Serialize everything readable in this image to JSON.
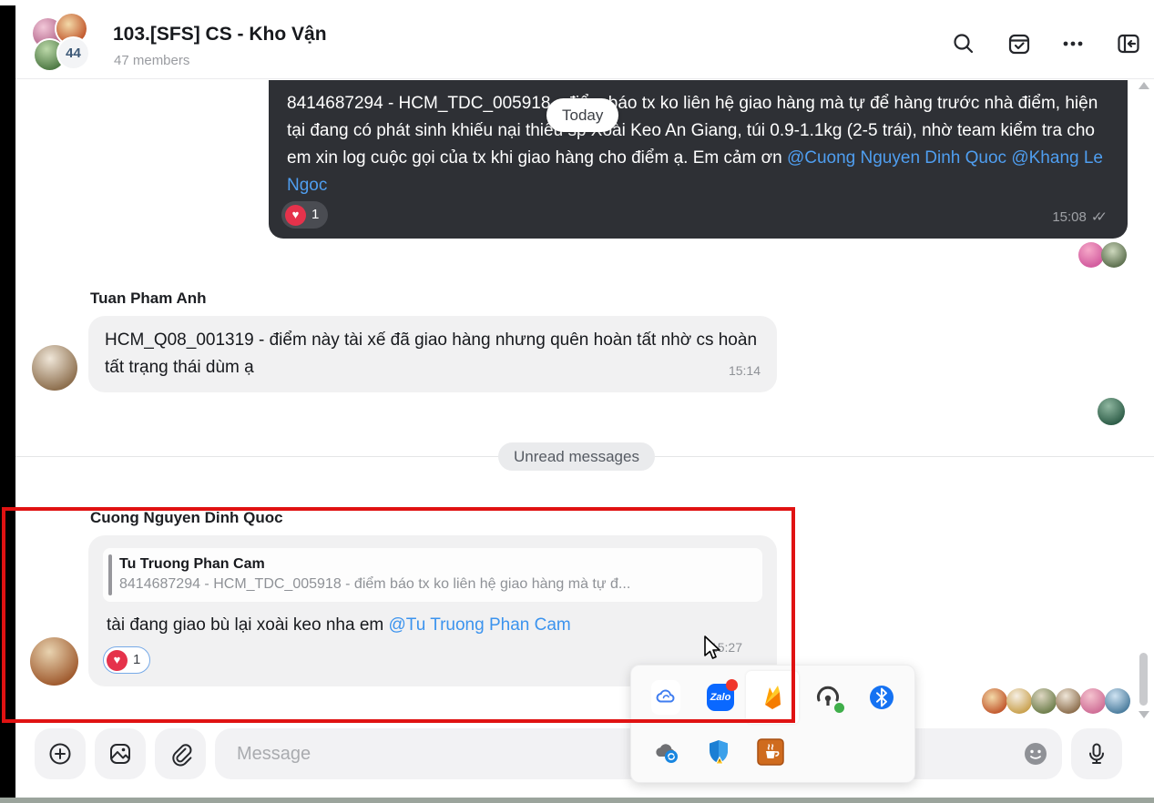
{
  "header": {
    "title": "103.[SFS] CS - Kho Vận",
    "subtitle": "47 members",
    "avatar_badge": "44"
  },
  "date_pill": "Today",
  "chat": {
    "pinned": {
      "text": "8414687294 - HCM_TDC_005918 - điểm báo tx ko liên hệ giao hàng mà tự để hàng trước nhà điểm, hiện tại đang có phát sinh khiếu nại thiếu sp Xoài Keo An Giang, túi 0.9-1.1kg (2-5 trái), nhờ team kiểm tra cho em xin log cuộc gọi của tx khi giao hàng cho điểm ạ. Em cảm ơn ",
      "mention1": "@Cuong Nguyen Dinh Quoc",
      "mention2": "@Khang Le Ngoc",
      "reaction_heart": "♥",
      "reaction_count": "1",
      "time": "15:08",
      "read_checks": "✓✓"
    },
    "tuan": {
      "name": "Tuan Pham Anh",
      "text": "HCM_Q08_001319 - điểm này tài xế đã giao hàng nhưng quên hoàn tất nhờ cs hoàn tất trạng thái dùm ạ",
      "time": "15:14"
    },
    "unread_label": "Unread messages",
    "cuong": {
      "name": "Cuong Nguyen Dinh Quoc",
      "reply_name": "Tu Truong Phan Cam",
      "reply_snippet": "8414687294 - HCM_TDC_005918 - điểm báo tx ko liên hệ giao hàng mà tự đ...",
      "text": "tài đang giao bù lại xoài keo nha em ",
      "mention": "@Tu Truong Phan Cam",
      "reaction_heart": "♥",
      "reaction_count": "1",
      "time": "15:27"
    }
  },
  "composer": {
    "placeholder": "Message"
  },
  "tray_popup": {
    "zalo_label": "Zalo",
    "icons": [
      "cloud-sync",
      "zalo",
      "firebase-orange",
      "openvpn",
      "bluetooth",
      "onedrive-sync",
      "windows-security",
      "java"
    ]
  },
  "colors": {
    "dark_bubble": "#2e3035",
    "light_bubble": "#f1f1f2",
    "mention_blue": "#3b93ee",
    "annotation_red": "#e01212",
    "zalo_blue": "#0a68ff",
    "bluetooth_blue": "#1572f2",
    "reaction_red": "#e5324b"
  }
}
